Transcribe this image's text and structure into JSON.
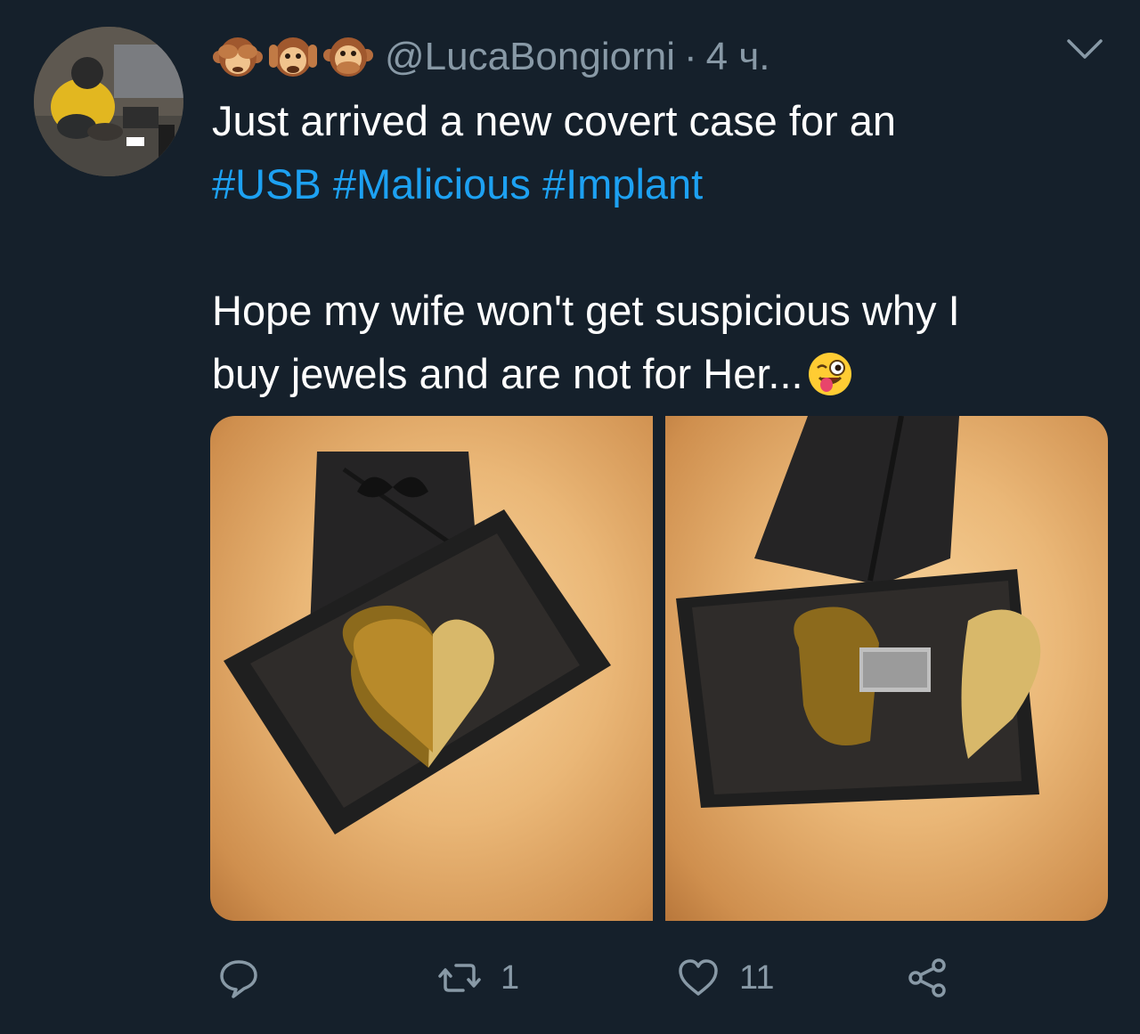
{
  "tweet": {
    "author_emojis": [
      "see-no-evil-monkey",
      "hear-no-evil-monkey",
      "speak-no-evil-monkey"
    ],
    "handle": "@LucaBongiorni",
    "separator": "·",
    "time": "4 ч.",
    "text": {
      "line1": "Just arrived a new covert case for an",
      "hashtags": [
        "#USB",
        "#Malicious",
        "#Implant"
      ],
      "line3": "Hope my wife won't get suspicious why I",
      "line4": "buy jewels and are not for Her...",
      "line4_emoji": "winking-face-with-tongue"
    },
    "media_count": 2,
    "actions": {
      "reply_count": "",
      "retweet_count": "1",
      "like_count": "11"
    }
  },
  "colors": {
    "background": "#15202b",
    "text": "#ffffff",
    "secondary": "#8899a6",
    "link": "#1da1f2"
  }
}
